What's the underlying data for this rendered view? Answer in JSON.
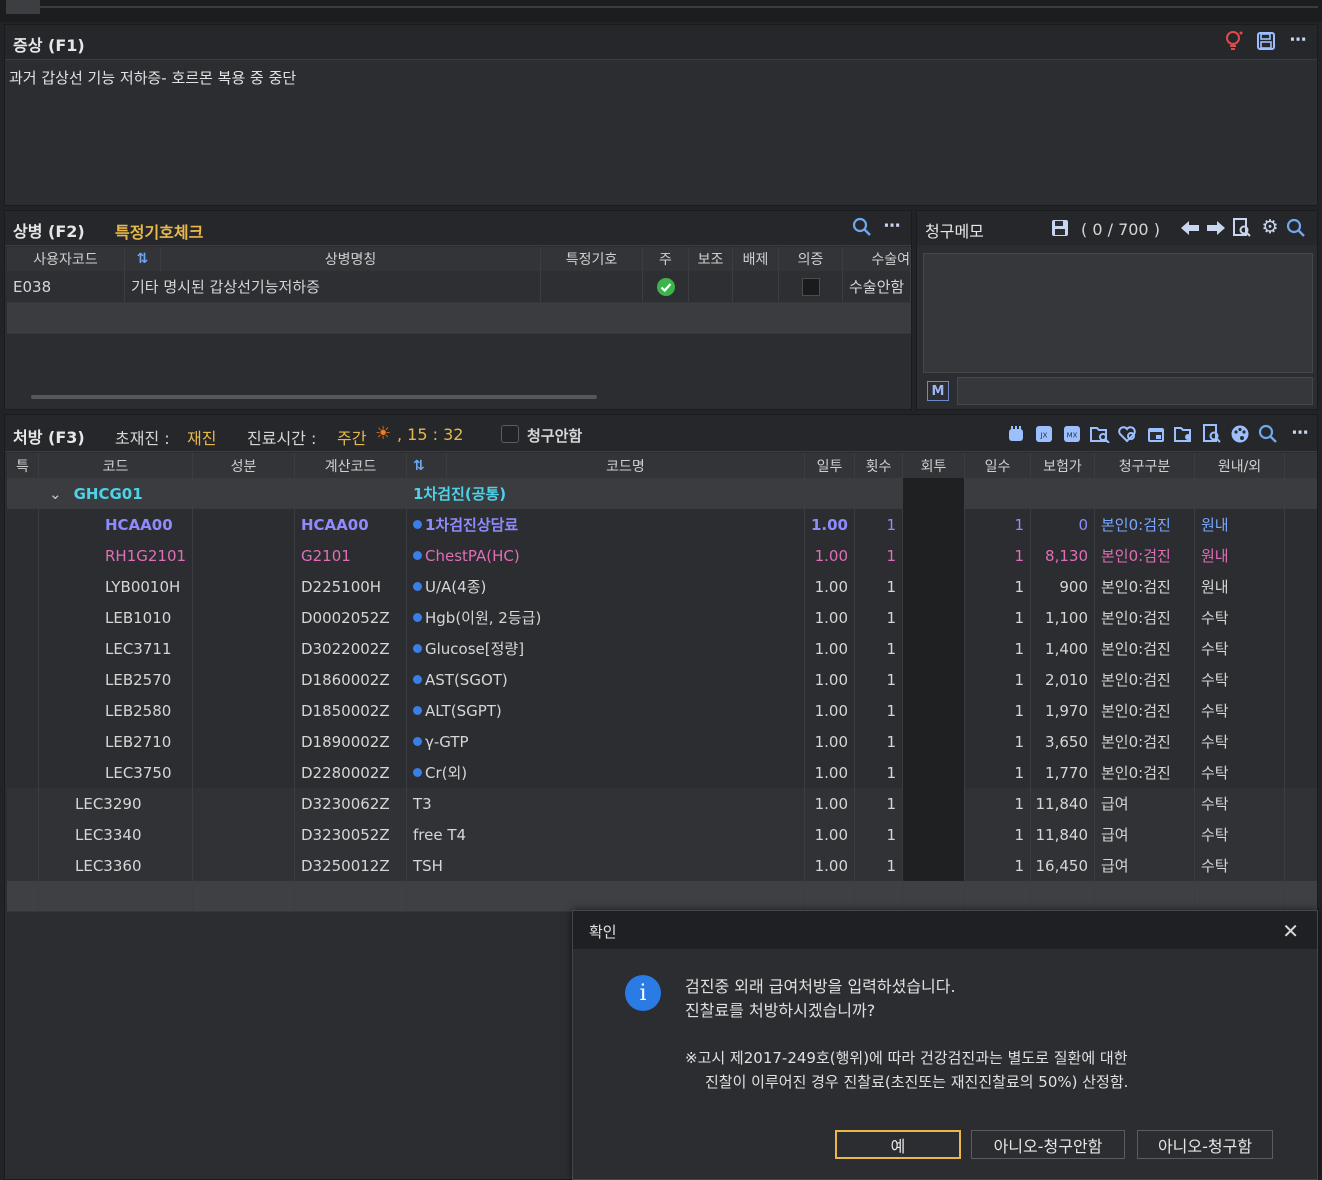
{
  "symptom": {
    "title": "증상 (F1)",
    "text": "과거 갑상선 기능 저하증- 호르몬 복용 중 중단"
  },
  "disease": {
    "title": "상병 (F2)",
    "link": "특정기호체크",
    "columns": [
      "사용자코드",
      "",
      "상병명칭",
      "특정기호",
      "주",
      "보조",
      "배제",
      "의증",
      "수술여"
    ],
    "rows": [
      {
        "code": "E038",
        "name": "기타 명시된 갑상선기능저하증",
        "special": "",
        "main_checked": true,
        "suspect_checked": false,
        "surgery": "수술안함"
      }
    ]
  },
  "memo": {
    "title": "청구메모",
    "counter": "( 0 / 700 )",
    "m_label": "M"
  },
  "rx": {
    "title": "처방 (F3)",
    "visit_label": "초재진 :",
    "visit_value": "재진",
    "time_label": "진료시간 :",
    "time_value": "주간",
    "time_clock": ", 15 : 32",
    "no_claim_label": "청구안함",
    "columns": [
      "특",
      "코드",
      "성분",
      "계산코드",
      "",
      "코드명",
      "일투",
      "횟수",
      "회투",
      "일수",
      "보험가",
      "청구구분",
      "원내/외"
    ],
    "group": {
      "code": "GHCG01",
      "name": "1차검진(공통)"
    },
    "items": [
      {
        "code": "HCAA00",
        "calc": "HCAA00",
        "name": "1차검진상담료",
        "dose": "1.00",
        "times": "1",
        "days": "1",
        "price": "0",
        "claim": "본인0:검진",
        "place": "원내",
        "style": "purple",
        "dot": true,
        "indent": true
      },
      {
        "code": "RH1G2101",
        "calc": "G2101",
        "name": "ChestPA(HC)",
        "dose": "1.00",
        "times": "1",
        "days": "1",
        "price": "8,130",
        "claim": "본인0:검진",
        "place": "원내",
        "style": "pink",
        "dot": true,
        "indent": true
      },
      {
        "code": "LYB0010H",
        "calc": "D225100H",
        "name": "U/A(4종)",
        "dose": "1.00",
        "times": "1",
        "days": "1",
        "price": "900",
        "claim": "본인0:검진",
        "place": "원내",
        "style": "",
        "dot": true,
        "indent": true
      },
      {
        "code": "LEB1010",
        "calc": "D0002052Z",
        "name": "Hgb(이원, 2등급)",
        "dose": "1.00",
        "times": "1",
        "days": "1",
        "price": "1,100",
        "claim": "본인0:검진",
        "place": "수탁",
        "style": "",
        "dot": true,
        "indent": true
      },
      {
        "code": "LEC3711",
        "calc": "D3022002Z",
        "name": "Glucose[정량]",
        "dose": "1.00",
        "times": "1",
        "days": "1",
        "price": "1,400",
        "claim": "본인0:검진",
        "place": "수탁",
        "style": "",
        "dot": true,
        "indent": true
      },
      {
        "code": "LEB2570",
        "calc": "D1860002Z",
        "name": "AST(SGOT)",
        "dose": "1.00",
        "times": "1",
        "days": "1",
        "price": "2,010",
        "claim": "본인0:검진",
        "place": "수탁",
        "style": "",
        "dot": true,
        "indent": true
      },
      {
        "code": "LEB2580",
        "calc": "D1850002Z",
        "name": "ALT(SGPT)",
        "dose": "1.00",
        "times": "1",
        "days": "1",
        "price": "1,970",
        "claim": "본인0:검진",
        "place": "수탁",
        "style": "",
        "dot": true,
        "indent": true
      },
      {
        "code": "LEB2710",
        "calc": "D1890002Z",
        "name": "γ-GTP",
        "dose": "1.00",
        "times": "1",
        "days": "1",
        "price": "3,650",
        "claim": "본인0:검진",
        "place": "수탁",
        "style": "",
        "dot": true,
        "indent": true
      },
      {
        "code": "LEC3750",
        "calc": "D2280002Z",
        "name": "Cr(외)",
        "dose": "1.00",
        "times": "1",
        "days": "1",
        "price": "1,770",
        "claim": "본인0:검진",
        "place": "수탁",
        "style": "",
        "dot": true,
        "indent": true
      },
      {
        "code": "LEC3290",
        "calc": "D3230062Z",
        "name": "T3",
        "dose": "1.00",
        "times": "1",
        "days": "1",
        "price": "11,840",
        "claim": "급여",
        "place": "수탁",
        "style": "",
        "dot": false,
        "indent": false
      },
      {
        "code": "LEC3340",
        "calc": "D3230052Z",
        "name": "free T4",
        "dose": "1.00",
        "times": "1",
        "days": "1",
        "price": "11,840",
        "claim": "급여",
        "place": "수탁",
        "style": "",
        "dot": false,
        "indent": false
      },
      {
        "code": "LEC3360",
        "calc": "D3250012Z",
        "name": "TSH",
        "dose": "1.00",
        "times": "1",
        "days": "1",
        "price": "16,450",
        "claim": "급여",
        "place": "수탁",
        "style": "",
        "dot": false,
        "indent": false
      }
    ]
  },
  "dialog": {
    "title": "확인",
    "line1": "검진중 외래 급여처방을 입력하셨습니다.",
    "line2": "진찰료를 처방하시겠습니까?",
    "note1": "※고시 제2017-249호(행위)에 따라 건강검진과는 별도로 질환에 대한",
    "note2": "진찰이 이루어진 경우 진찰료(초진또는 재진진찰료의 50%) 산정함.",
    "btn_yes": "예",
    "btn_no_noclaim": "아니오-청구안함",
    "btn_no_claim": "아니오-청구함"
  }
}
